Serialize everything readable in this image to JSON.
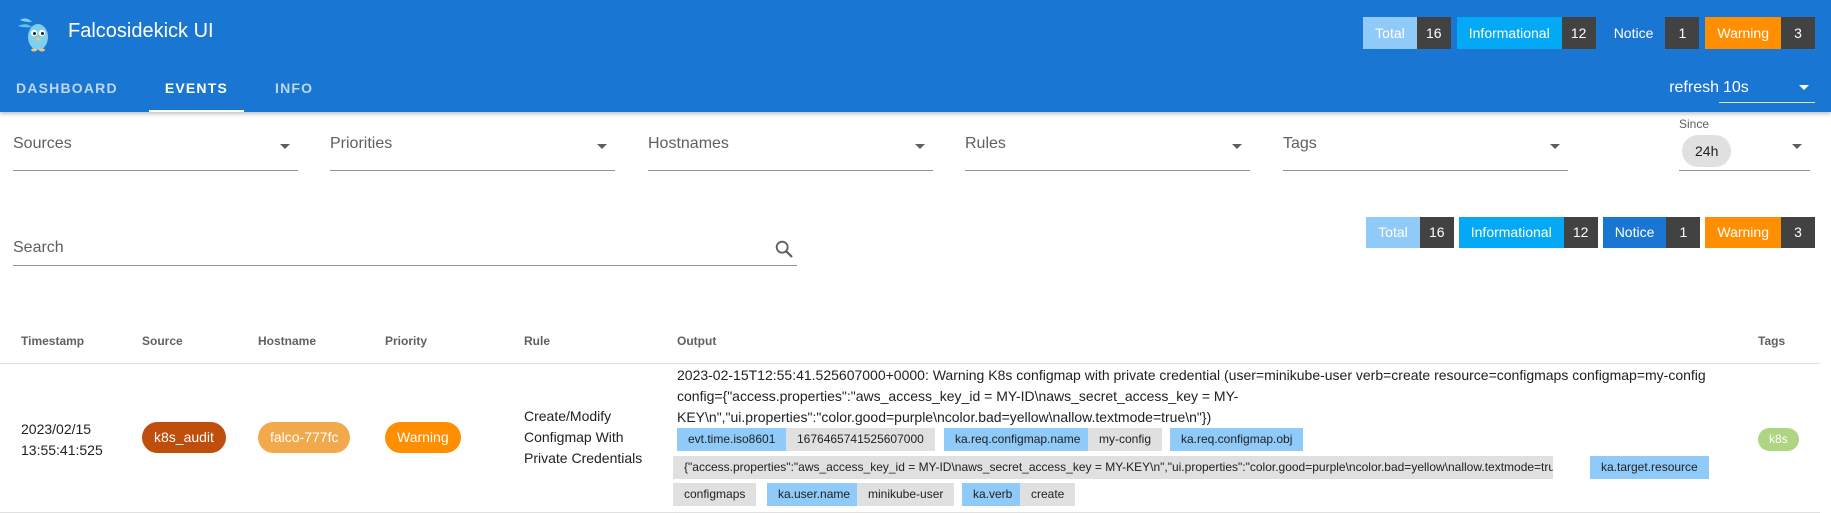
{
  "app": {
    "title": "Falcosidekick UI"
  },
  "colors": {
    "header": "#1976d2",
    "total": "#90caf9",
    "informational": "#03a9f4",
    "notice": "#1976d2",
    "warning": "#ff8f00",
    "count_bg": "#424242",
    "source_chip": "#bf4d0c",
    "hostname_chip": "#f2a94c",
    "priority_chip": "#ff8f00",
    "tag_chip": "#aed581"
  },
  "header_counters": [
    {
      "label": "Total",
      "count": "16"
    },
    {
      "label": "Informational",
      "count": "12"
    },
    {
      "label": "Notice",
      "count": "1"
    },
    {
      "label": "Warning",
      "count": "3"
    }
  ],
  "tabs": [
    {
      "label": "DASHBOARD"
    },
    {
      "label": "EVENTS"
    },
    {
      "label": "INFO"
    }
  ],
  "refresh": {
    "label": "refresh",
    "value": "10s"
  },
  "filters": {
    "sources": "Sources",
    "priorities": "Priorities",
    "hostnames": "Hostnames",
    "rules": "Rules",
    "tags": "Tags",
    "since_label": "Since",
    "since_value": "24h"
  },
  "search": {
    "placeholder": "Search"
  },
  "stats_counters": [
    {
      "label": "Total",
      "count": "16"
    },
    {
      "label": "Informational",
      "count": "12"
    },
    {
      "label": "Notice",
      "count": "1"
    },
    {
      "label": "Warning",
      "count": "3"
    }
  ],
  "table": {
    "headers": [
      "Timestamp",
      "Source",
      "Hostname",
      "Priority",
      "Rule",
      "Output",
      "Tags"
    ],
    "rows": [
      {
        "timestamp_date": "2023/02/15",
        "timestamp_time": "13:55:41:525",
        "source": "k8s_audit",
        "hostname": "falco-777fc",
        "priority": "Warning",
        "rule_line1": "Create/Modify",
        "rule_line2": "Configmap With",
        "rule_line3": "Private Credentials",
        "output_line1": "2023-02-15T12:55:41.525607000+0000: Warning K8s configmap with private credential (user=minikube-user verb=create resource=configmaps configmap=my-config",
        "output_line2": "config={\"access.properties\":\"aws_access_key_id = MY-ID\\naws_secret_access_key = MY-",
        "output_line3": "KEY\\n\",\"ui.properties\":\"color.good=purple\\ncolor.bad=yellow\\nallow.textmode=true\\n\"})",
        "fields": {
          "evt_time_key": "evt.time.iso8601",
          "evt_time_val": "1676465741525607000",
          "cm_name_key": "ka.req.configmap.name",
          "cm_name_val": "my-config",
          "cm_obj_key": "ka.req.configmap.obj",
          "cm_obj_val": "{\"access.properties\":\"aws_access_key_id = MY-ID\\naws_secret_access_key = MY-KEY\\n\",\"ui.properties\":\"color.good=purple\\ncolor.bad=yellow\\nallow.textmode=true\\n\"}",
          "target_key": "ka.target.resource",
          "target_val": "configmaps",
          "user_key": "ka.user.name",
          "user_val": "minikube-user",
          "verb_key": "ka.verb",
          "verb_val": "create"
        },
        "tag": "k8s"
      }
    ]
  }
}
